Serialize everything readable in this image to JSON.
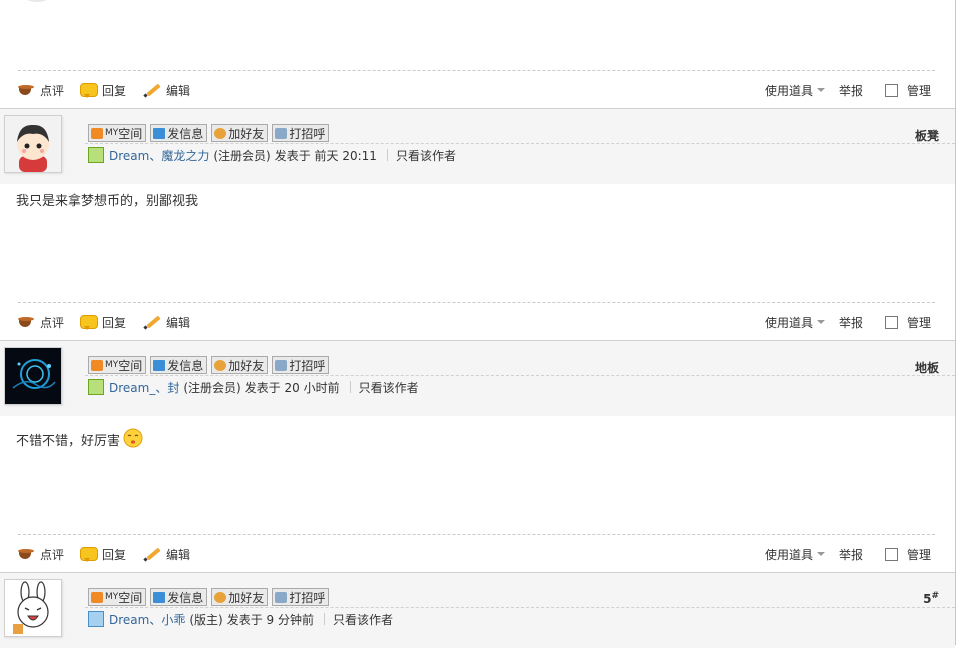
{
  "actions": {
    "comment": "点评",
    "reply": "回复",
    "edit": "编辑",
    "tools": "使用道具",
    "report": "举报",
    "manage": "管理"
  },
  "profile_buttons": {
    "space_prefix": "MY",
    "space": "空间",
    "message": "发信息",
    "add_friend": "加好友",
    "greet": "打招呼"
  },
  "posts": [
    {
      "user": "Dream、魔龙之力",
      "role": "(注册会员)",
      "posted": "发表于 前天 20:11",
      "only_author": "只看该作者",
      "floor": "板凳",
      "floor_sup": "",
      "content": "我只是来拿梦想币的，别鄙视我"
    },
    {
      "user": "Dream_、封",
      "role": "(注册会员)",
      "posted": "发表于 20 小时前",
      "only_author": "只看该作者",
      "floor": "地板",
      "floor_sup": "",
      "content": "不错不错，好厉害"
    },
    {
      "user": "Dream、小乖",
      "role": "(版主)",
      "posted": "发表于 9 分钟前",
      "only_author": "只看该作者",
      "floor": "5",
      "floor_sup": "#",
      "content": ""
    }
  ]
}
